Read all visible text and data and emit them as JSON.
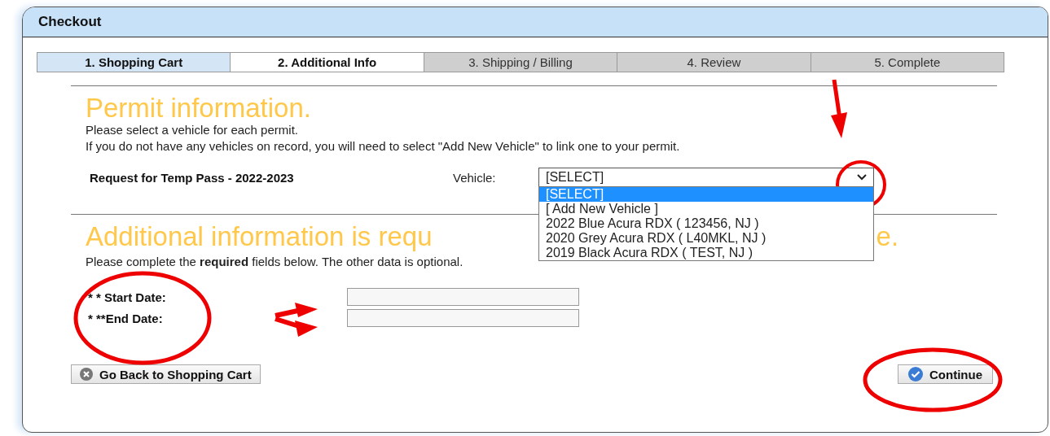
{
  "window": {
    "title": "Checkout"
  },
  "tabs": [
    {
      "label": "1. Shopping Cart",
      "selected": false,
      "completed": true
    },
    {
      "label": "2. Additional Info",
      "selected": true,
      "completed": false
    },
    {
      "label": "3. Shipping / Billing",
      "selected": false,
      "completed": false
    },
    {
      "label": "4. Review",
      "selected": false,
      "completed": false
    },
    {
      "label": "5. Complete",
      "selected": false,
      "completed": false
    }
  ],
  "permit": {
    "heading": "Permit information.",
    "lines": [
      "Please select a vehicle for each permit.",
      "If you do not have any vehicles on record, you will need to select \"Add New Vehicle\" to link one to your permit."
    ],
    "item": "Request for Temp Pass - 2022-2023",
    "vehicle_label": "Vehicle:",
    "vehicle_value": "[SELECT]",
    "options": [
      {
        "label": "[SELECT]",
        "selected": true
      },
      {
        "label": "[ Add New Vehicle ]",
        "selected": false
      },
      {
        "label": "2022 Blue Acura RDX ( 123456, NJ )",
        "selected": false
      },
      {
        "label": "2020 Grey Acura RDX ( L40MKL, NJ )",
        "selected": false
      },
      {
        "label": "2019 Black Acura RDX ( TEST, NJ )",
        "selected": false
      }
    ]
  },
  "additional": {
    "heading_parts": [
      "Additional information is requ",
      "e."
    ],
    "note": "Please complete the **required** fields below. The other data is optional.",
    "fields": [
      {
        "label": "* * Start Date:"
      },
      {
        "label": "* **End Date:"
      }
    ]
  },
  "buttons": {
    "back": "Go Back to Shopping Cart",
    "continue": "Continue"
  }
}
